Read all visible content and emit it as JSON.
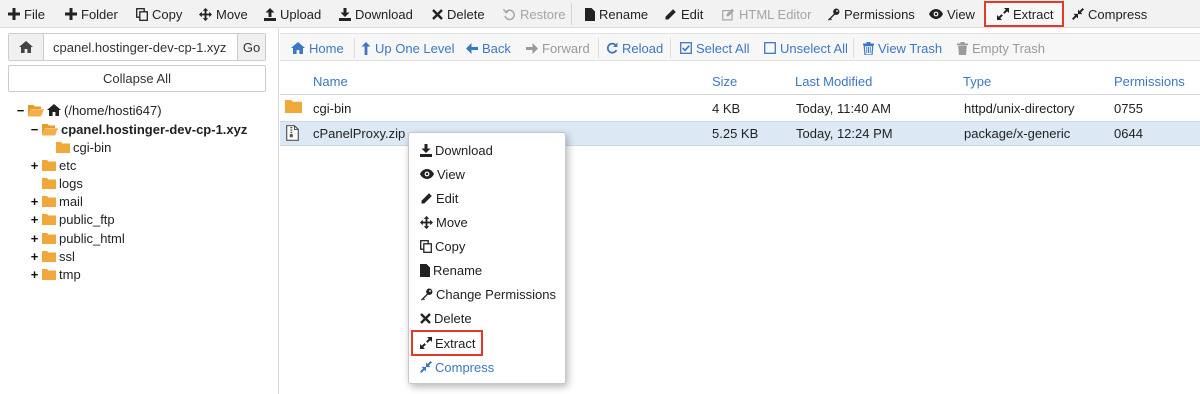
{
  "toolbar": {
    "file": "File",
    "folder": "Folder",
    "copy": "Copy",
    "move": "Move",
    "upload": "Upload",
    "download": "Download",
    "delete": "Delete",
    "restore": "Restore",
    "rename": "Rename",
    "edit": "Edit",
    "html_editor": "HTML Editor",
    "permissions": "Permissions",
    "view": "View",
    "extract": "Extract",
    "compress": "Compress"
  },
  "address": {
    "value": "cpanel.hostinger-dev-cp-1.xyz",
    "go": "Go"
  },
  "collapse_all": "Collapse All",
  "tree": {
    "root": "(/home/hosti647)",
    "domain": "cpanel.hostinger-dev-cp-1.xyz",
    "cgi_bin": "cgi-bin",
    "etc": "etc",
    "logs": "logs",
    "mail": "mail",
    "public_ftp": "public_ftp",
    "public_html": "public_html",
    "ssl": "ssl",
    "tmp": "tmp"
  },
  "nav": {
    "home": "Home",
    "up_one_level": "Up One Level",
    "back": "Back",
    "forward": "Forward",
    "reload": "Reload",
    "select_all": "Select All",
    "unselect_all": "Unselect All",
    "view_trash": "View Trash",
    "empty_trash": "Empty Trash"
  },
  "table": {
    "headers": {
      "name": "Name",
      "size": "Size",
      "modified": "Last Modified",
      "type": "Type",
      "perms": "Permissions"
    },
    "rows": [
      {
        "name": "cgi-bin",
        "size": "4 KB",
        "modified": "Today, 11:40 AM",
        "type": "httpd/unix-directory",
        "perms": "0755",
        "icon": "folder-icon"
      },
      {
        "name": "cPanelProxy.zip",
        "size": "5.25 KB",
        "modified": "Today, 12:24 PM",
        "type": "package/x-generic",
        "perms": "0644",
        "icon": "zip-file-icon"
      }
    ]
  },
  "context_menu": {
    "download": "Download",
    "view": "View",
    "edit": "Edit",
    "move": "Move",
    "copy": "Copy",
    "rename": "Rename",
    "change_permissions": "Change Permissions",
    "delete": "Delete",
    "extract": "Extract",
    "compress": "Compress"
  },
  "colors": {
    "link_blue": "#3b78c4",
    "folder": "#f0a83a",
    "selected_row": "#dce9f5",
    "highlight_red": "#e23a2a",
    "toolbar_bg": "#f2f2f2"
  }
}
